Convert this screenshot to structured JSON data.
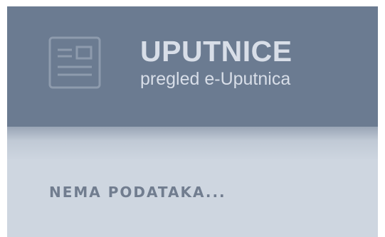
{
  "header": {
    "icon": "document-icon",
    "title": "UPUTNICE",
    "subtitle": "pregled e-Uputnica"
  },
  "body": {
    "empty_message": "NEMA PODATAKA..."
  },
  "colors": {
    "header_bg": "#6b7b91",
    "header_text": "#d8dee8",
    "body_bg": "#ced6e0",
    "empty_text": "#717d8f"
  }
}
